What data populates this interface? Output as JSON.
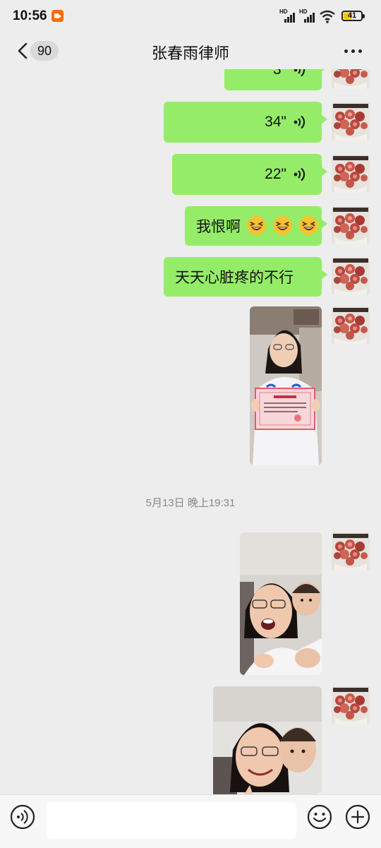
{
  "status_bar": {
    "time": "10:56",
    "battery": "41",
    "net1": "HD",
    "net2": "HD",
    "icons": [
      "screen-record-icon",
      "signal-icon",
      "wifi-icon",
      "battery-icon"
    ]
  },
  "nav": {
    "back_badge": "90",
    "title": "张春雨律师",
    "icons": [
      "back-chevron-icon",
      "more-icon"
    ]
  },
  "messages": {
    "voice_top_duration": "3\"",
    "voice_2_duration": "34\"",
    "voice_3_duration": "22\"",
    "text_1": "我恨啊",
    "text_1_emoji": [
      "grinning-squint-emoji",
      "grinning-squint-emoji",
      "grinning-squint-emoji"
    ],
    "text_2": "天天心脏疼的不行",
    "timestamp": "5月13日 晚上19:31",
    "photos": [
      "girl-holding-certificate-photo",
      "girl-and-baby-selfie-photo",
      "girl-and-baby-selfie-photo-2"
    ]
  },
  "bottom_bar": {
    "input_value": "",
    "icons": [
      "voice-input-icon",
      "emoji-icon",
      "plus-icon"
    ]
  },
  "colors": {
    "background": "#ededed",
    "bubble_green": "#95ec69",
    "timestamp": "#888888"
  }
}
